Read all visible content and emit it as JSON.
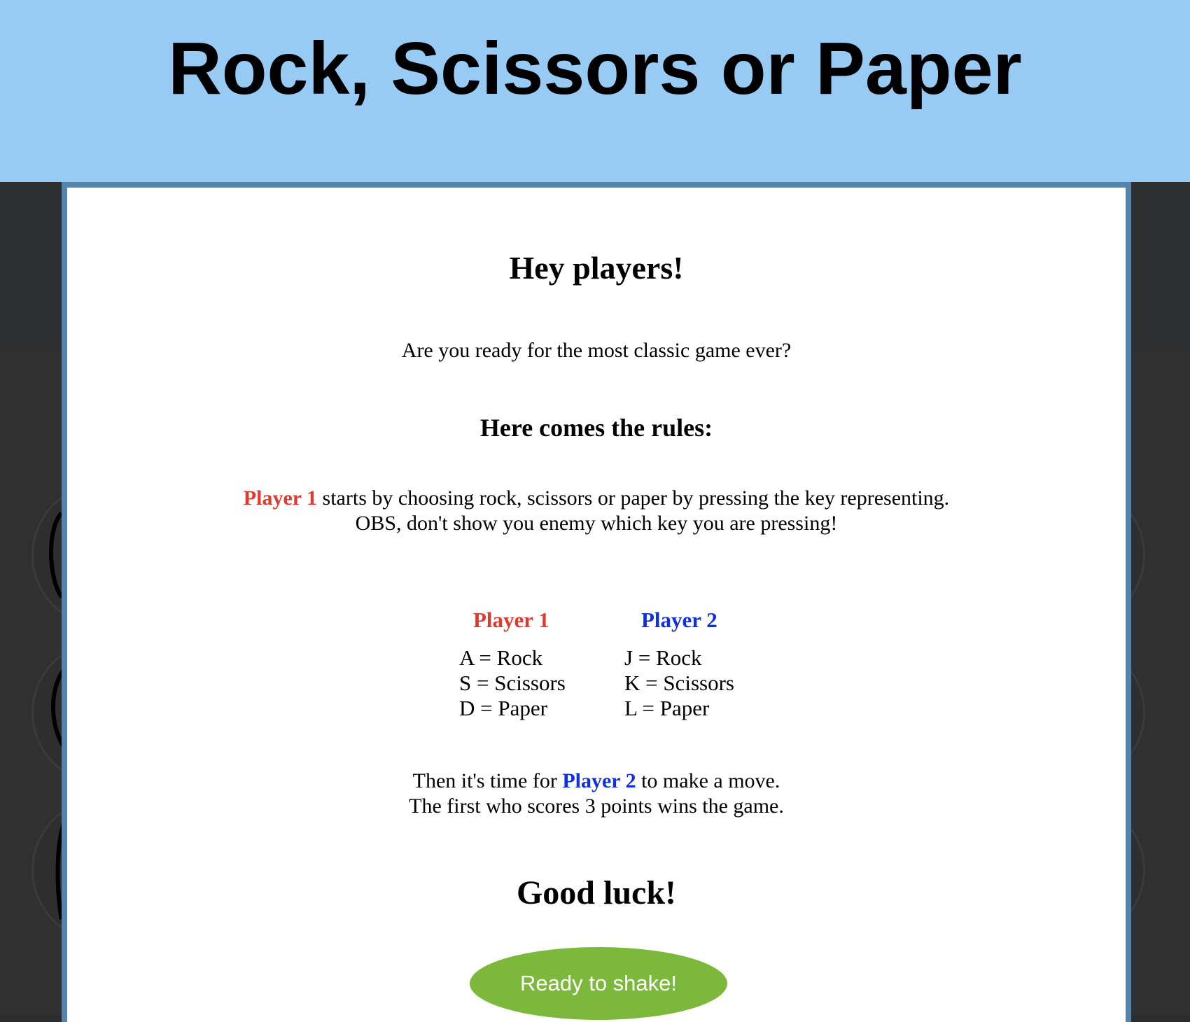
{
  "header": {
    "title": "Rock, Scissors or Paper"
  },
  "modal": {
    "greeting": "Hey players!",
    "intro": "Are you ready for the most classic game ever?",
    "rules_heading": "Here comes the rules:",
    "rules_player_label": "Player 1",
    "rules_line1_rest": " starts by choosing rock, scissors or paper by pressing the key representing.",
    "rules_line2": "OBS, don't show you enemy which key you are pressing!",
    "player1": {
      "label": "Player 1",
      "keys": [
        "A = Rock",
        "S = Scissors",
        "D = Paper"
      ]
    },
    "player2": {
      "label": "Player 2",
      "keys": [
        "J = Rock",
        "K = Scissors",
        "L = Paper"
      ]
    },
    "then_prefix": "Then it's time for ",
    "then_player_label": "Player 2",
    "then_suffix": " to make a move.",
    "then_line2": "The first who scores 3 points wins the game.",
    "good_luck": "Good luck!",
    "button_label": "Ready to shake!"
  },
  "colors": {
    "player1": "#e03a2d",
    "player2": "#1030e0",
    "header_bg": "#97cbf4",
    "button_bg": "#7cb83c",
    "modal_border": "#5384ad"
  },
  "icons": [
    "rock-hand-icon",
    "scissors-hand-icon",
    "paper-hand-icon"
  ]
}
